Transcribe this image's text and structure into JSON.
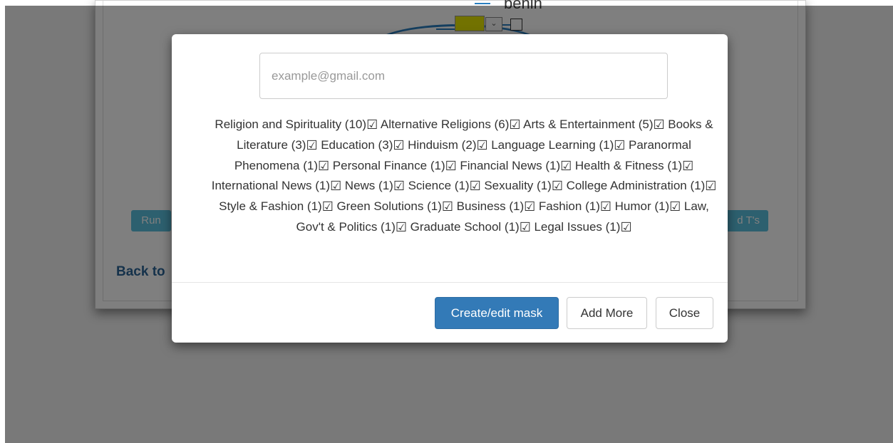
{
  "background": {
    "diagram_text": "benin",
    "run_button_label": "Run",
    "right_button_label": "d T's",
    "back_link_label": "Back to"
  },
  "modal": {
    "email_placeholder": "example@gmail.com",
    "categories": [
      {
        "name": "Religion and Spirituality",
        "count": 10
      },
      {
        "name": "Alternative Religions",
        "count": 6
      },
      {
        "name": "Arts & Entertainment",
        "count": 5
      },
      {
        "name": "Books & Literature",
        "count": 3
      },
      {
        "name": "Education",
        "count": 3
      },
      {
        "name": "Hinduism",
        "count": 2
      },
      {
        "name": "Language Learning",
        "count": 1
      },
      {
        "name": "Paranormal Phenomena",
        "count": 1
      },
      {
        "name": "Personal Finance",
        "count": 1
      },
      {
        "name": "Financial News",
        "count": 1
      },
      {
        "name": "Health & Fitness",
        "count": 1
      },
      {
        "name": "International News",
        "count": 1
      },
      {
        "name": "News",
        "count": 1
      },
      {
        "name": "Science",
        "count": 1
      },
      {
        "name": "Sexuality",
        "count": 1
      },
      {
        "name": "College Administration",
        "count": 1
      },
      {
        "name": "Style & Fashion",
        "count": 1
      },
      {
        "name": "Green Solutions",
        "count": 1
      },
      {
        "name": "Business",
        "count": 1
      },
      {
        "name": "Fashion",
        "count": 1
      },
      {
        "name": "Humor",
        "count": 1
      },
      {
        "name": "Law, Gov't & Politics",
        "count": 1
      },
      {
        "name": "Graduate School",
        "count": 1
      },
      {
        "name": "Legal Issues",
        "count": 1
      }
    ],
    "checkbox_glyph": "☑",
    "footer": {
      "create_label": "Create/edit mask",
      "add_more_label": "Add More",
      "close_label": "Close"
    }
  },
  "colors": {
    "primary": "#337ab7",
    "info": "#5bc0de",
    "link": "#2a6496"
  }
}
